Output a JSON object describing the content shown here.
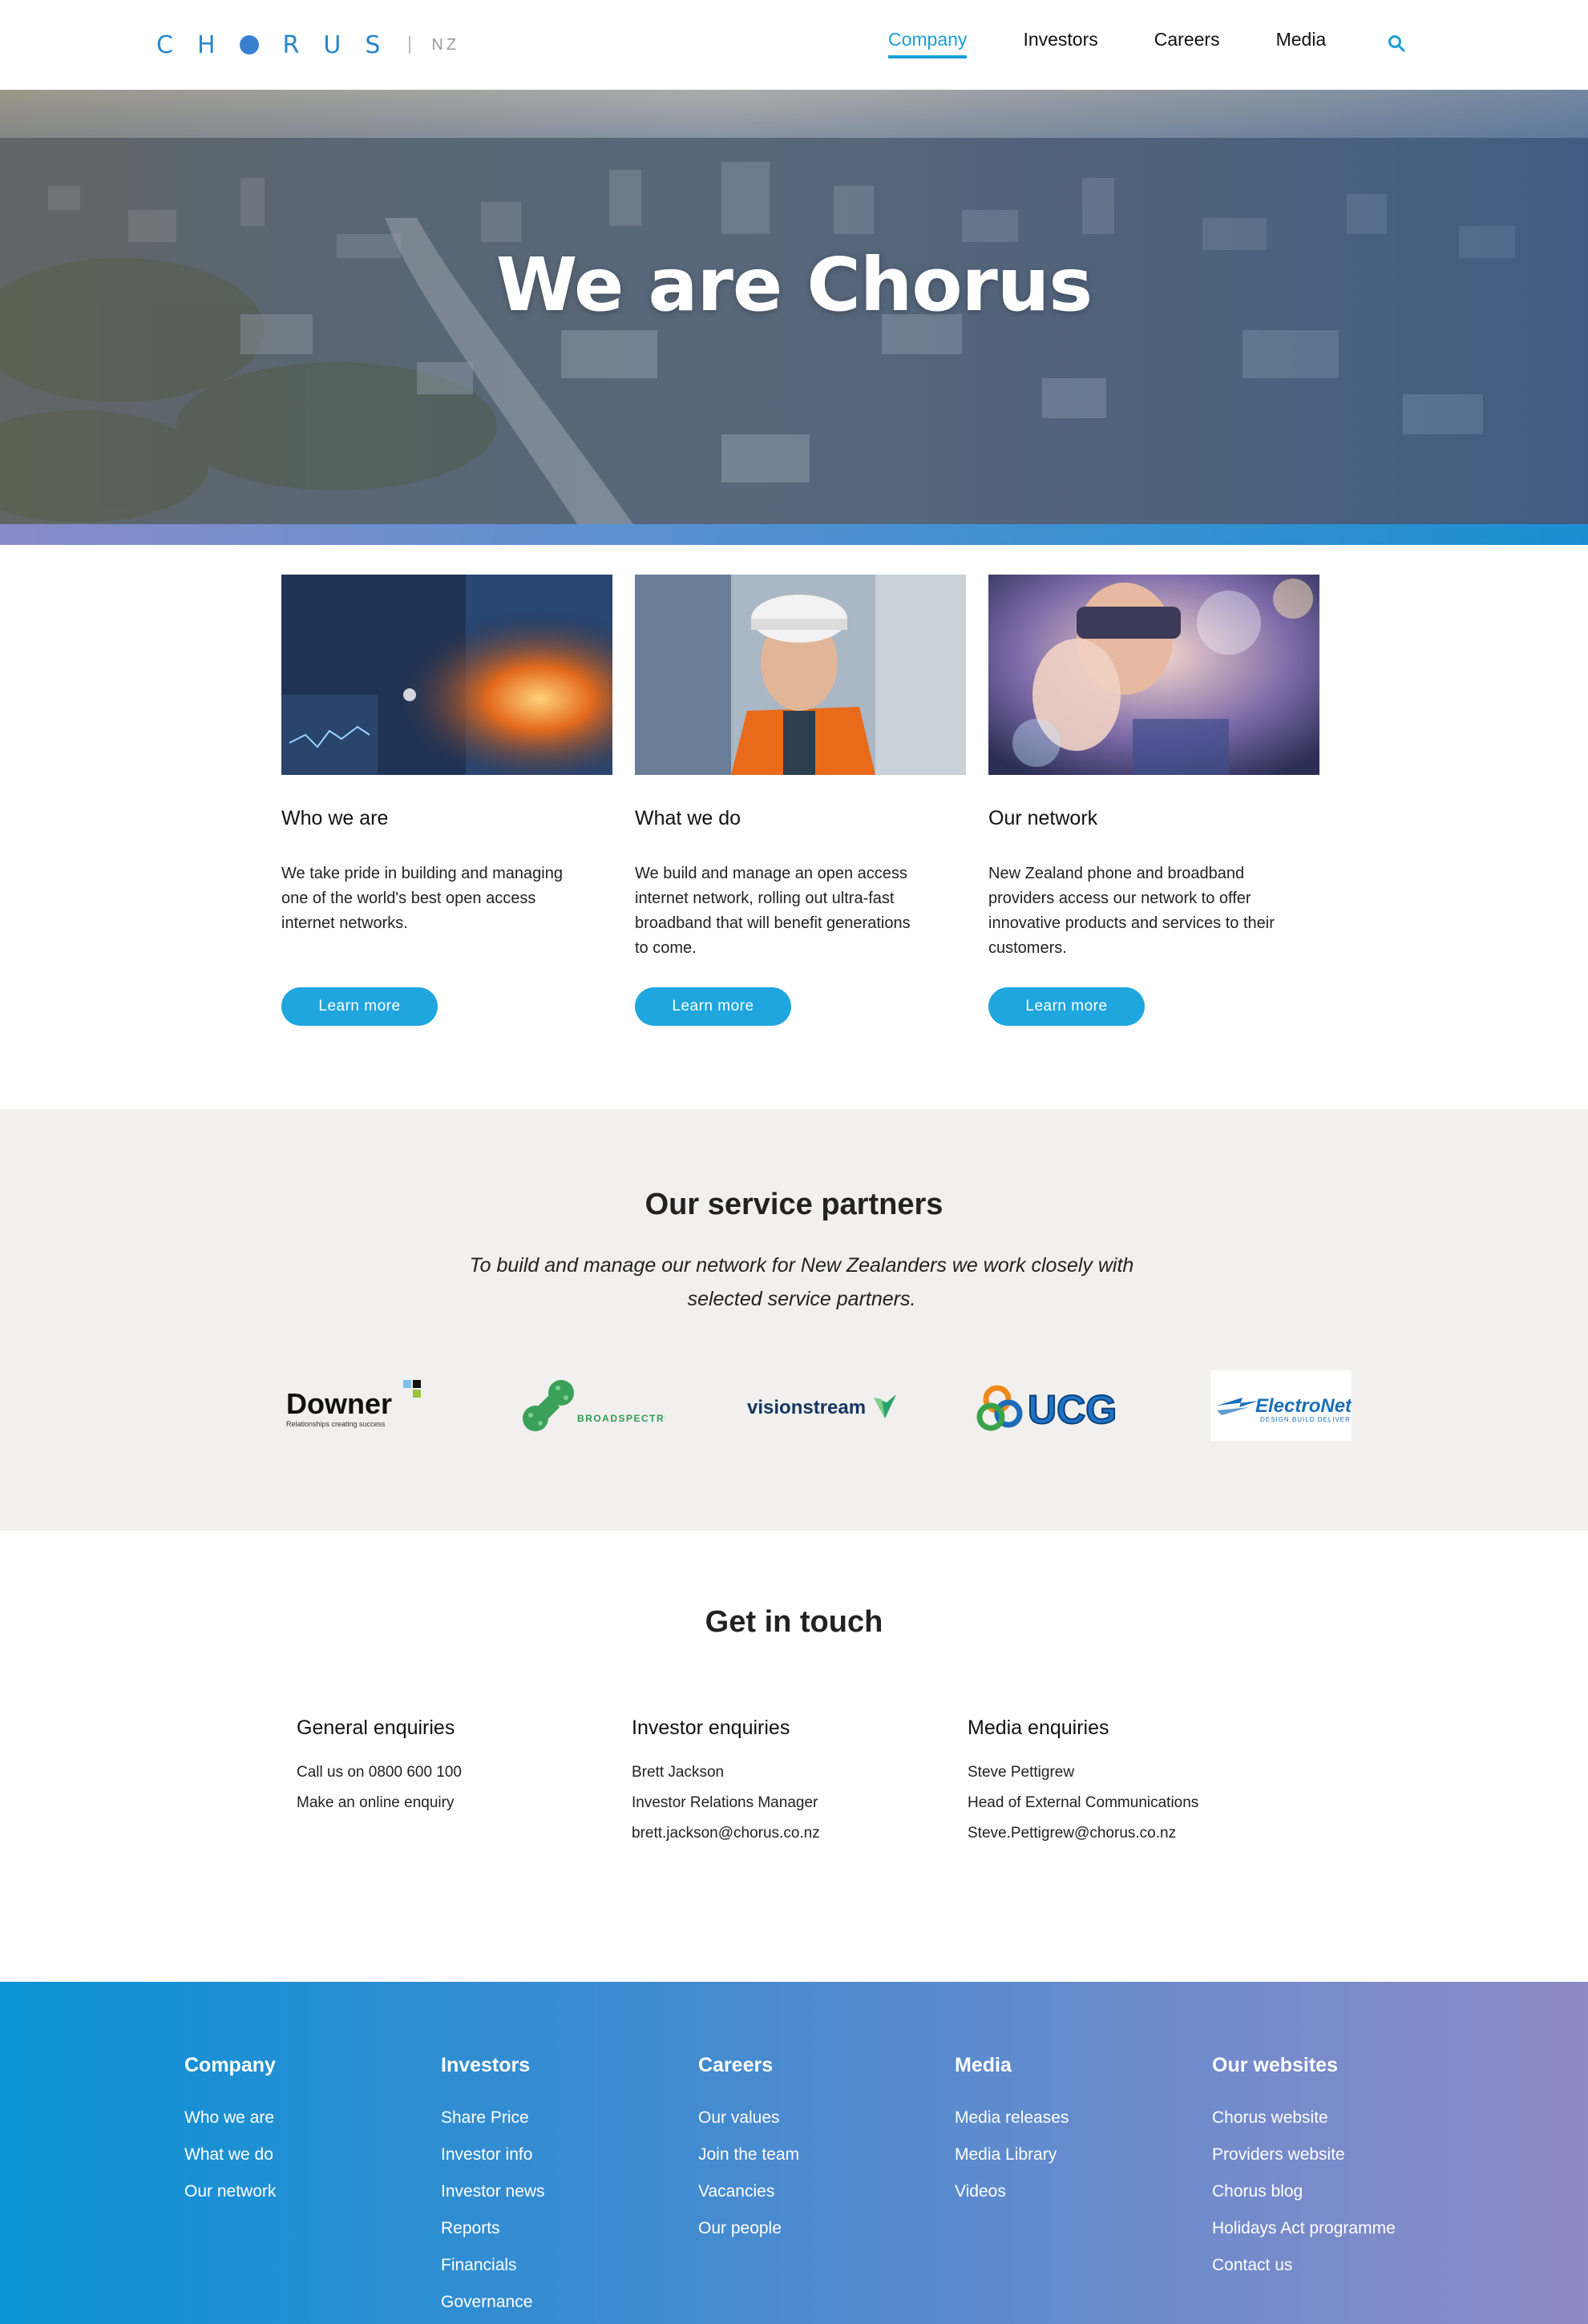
{
  "header": {
    "logo_text": "CH RUS",
    "logo_region": "NZ",
    "nav": [
      "Company",
      "Investors",
      "Careers",
      "Media"
    ],
    "active_nav": "Company"
  },
  "hero": {
    "title": "We are Chorus"
  },
  "cards": [
    {
      "title": "Who we are",
      "desc": "We take pride in building and managing one of the world's best open access internet networks.",
      "button": "Learn more"
    },
    {
      "title": "What we do",
      "desc": "We build and manage an open access internet network, rolling out ultra-fast broadband that will benefit generations to come.",
      "button": "Learn more"
    },
    {
      "title": "Our network",
      "desc": "New Zealand phone and broadband providers access our network to offer innovative products and services to their customers.",
      "button": "Learn more"
    }
  ],
  "partners": {
    "title": "Our service partners",
    "subtitle": "To build and manage our network for New Zealanders we work closely with selected service partners.",
    "logos": [
      {
        "name": "Downer",
        "tagline": "Relationships creating success"
      },
      {
        "name": "BROADSPECTRUM"
      },
      {
        "name": "visionstream"
      },
      {
        "name": "UCG"
      },
      {
        "name": "ElectroNet",
        "tagline": "DESIGN.BUILD.DELIVER"
      }
    ]
  },
  "contact": {
    "title": "Get in touch",
    "columns": [
      {
        "head": "General enquiries",
        "lines": [
          "Call us on 0800 600 100",
          "Make an online enquiry"
        ]
      },
      {
        "head": "Investor enquiries",
        "lines": [
          "Brett Jackson",
          "Investor Relations Manager",
          "brett.jackson@chorus.co.nz"
        ]
      },
      {
        "head": "Media enquiries",
        "lines": [
          "Steve Pettigrew",
          "Head of External Communications",
          "Steve.Pettigrew@chorus.co.nz"
        ]
      }
    ]
  },
  "footer": {
    "columns": [
      {
        "head": "Company",
        "links": [
          "Who we are",
          "What we do",
          "Our network"
        ]
      },
      {
        "head": "Investors",
        "links": [
          "Share Price",
          "Investor info",
          "Investor news",
          "Reports",
          "Financials",
          "Governance"
        ]
      },
      {
        "head": "Careers",
        "links": [
          "Our values",
          "Join the team",
          "Vacancies",
          "Our people"
        ]
      },
      {
        "head": "Media",
        "links": [
          "Media releases",
          "Media Library",
          "Videos"
        ]
      },
      {
        "head": "Our websites",
        "links": [
          "Chorus website",
          "Providers website",
          "Chorus blog",
          "Holidays Act programme",
          "Contact us"
        ]
      }
    ]
  },
  "colors": {
    "accent": "#1aa0d8",
    "button": "#1fa6de",
    "partners_bg": "#f1f0ee"
  }
}
